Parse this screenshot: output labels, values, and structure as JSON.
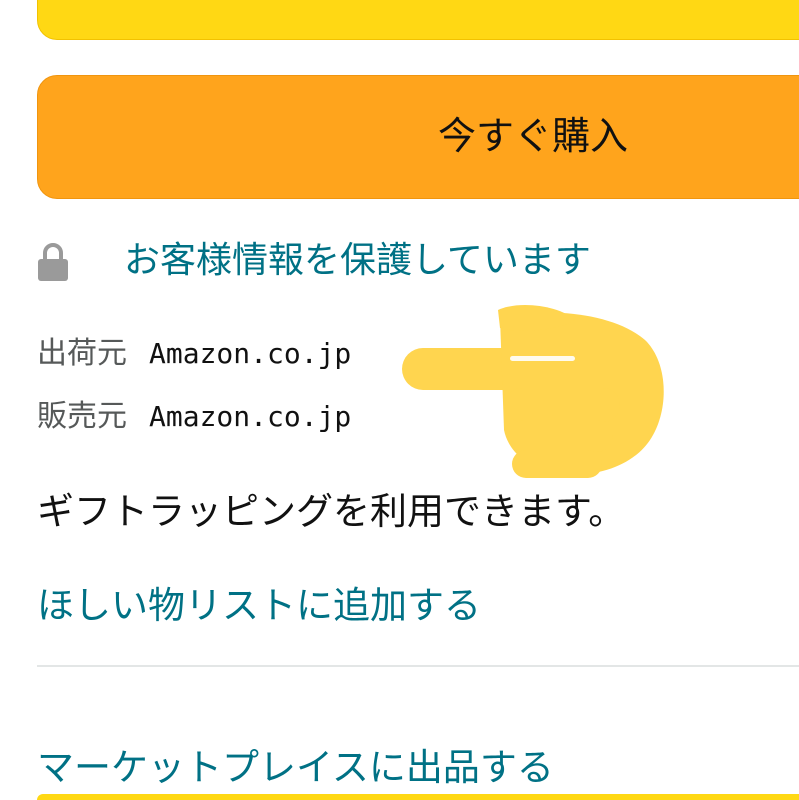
{
  "buttons": {
    "add_to_cart_label": "",
    "buy_now_label": "今すぐ購入"
  },
  "security": {
    "icon": "lock-icon",
    "text": "お客様情報を保護しています"
  },
  "fulfillment": {
    "ship_from_label": "出荷元",
    "ship_from_value": "Amazon.co.jp",
    "sold_by_label": "販売元",
    "sold_by_value": "Amazon.co.jp"
  },
  "gift_text": "ギフトラッピングを利用できます。",
  "links": {
    "wishlist": "ほしい物リストに追加する",
    "sell_on_marketplace": "マーケットプレイスに出品する"
  },
  "overlay": {
    "icon": "pointing-right-hand-emoji"
  },
  "colors": {
    "add_to_cart": "#ffd814",
    "buy_now": "#ffa41c",
    "link": "#007185",
    "secondary_text": "#565959",
    "hand_emoji": "#ffd54f"
  }
}
